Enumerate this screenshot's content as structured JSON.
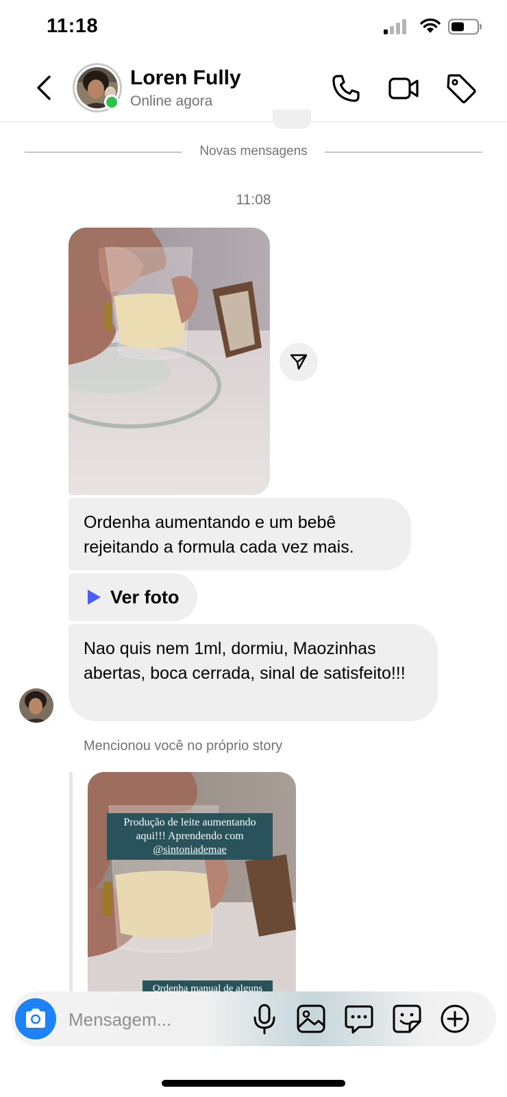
{
  "status_bar": {
    "time": "11:18",
    "icons": [
      "signal-icon",
      "wifi-icon",
      "battery-icon"
    ]
  },
  "header": {
    "contact_name": "Loren Fully",
    "contact_status": "Online agora",
    "actions": [
      "back-icon",
      "phone-icon",
      "video-icon",
      "tag-icon"
    ]
  },
  "conversation": {
    "divider_label": "Novas mensagens",
    "timestamp": "11:08",
    "messages": [
      {
        "type": "photo"
      },
      {
        "type": "text",
        "text": "Ordenha aumentando e um bebê rejeitando a formula cada vez mais."
      },
      {
        "type": "link",
        "label": "Ver foto"
      },
      {
        "type": "text",
        "text": "Nao quis nem 1ml, dormiu, Maozinhas abertas, boca cerrada, sinal de satisfeito!!!"
      }
    ],
    "mention_note": "Mencionou você no próprio story",
    "story": {
      "caption_line1": "Produção de leite aumentando",
      "caption_line2": "aqui!!! Aprendendo com",
      "caption_handle": "@sintoniademae",
      "caption_bottom": "Ordenha manual de alguns"
    }
  },
  "composer": {
    "placeholder": "Mensagem...",
    "icons": [
      "camera-icon",
      "microphone-icon",
      "gallery-icon",
      "chat-bubble-icon",
      "sticker-icon",
      "plus-icon"
    ]
  },
  "colors": {
    "online": "#2dc24b",
    "bubble": "#efefef",
    "camera_button": "#1c82f6",
    "play_triangle": "#4a5cf2",
    "story_caption_bg": "#29525a"
  }
}
